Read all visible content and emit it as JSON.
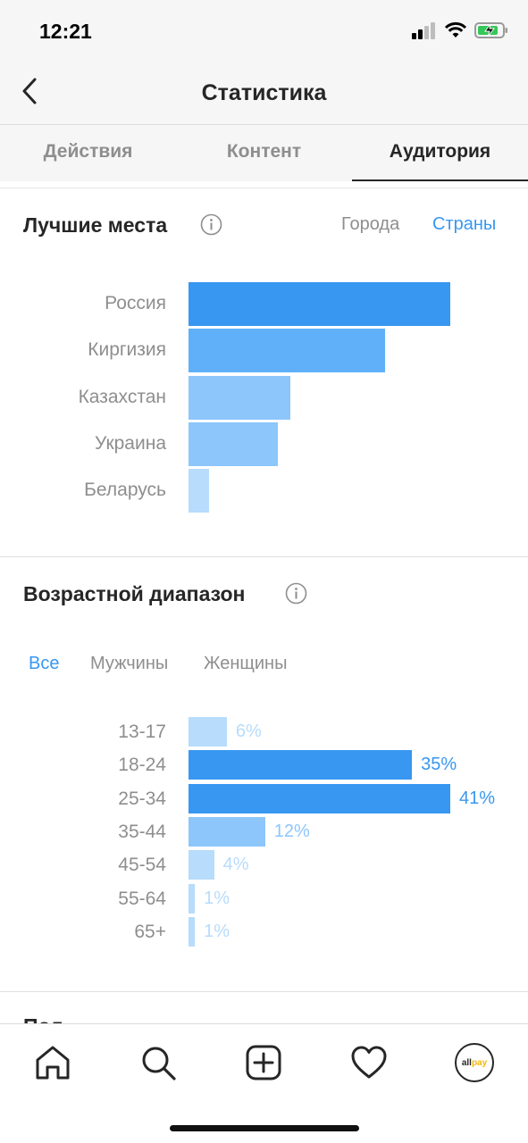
{
  "status": {
    "time": "12:21"
  },
  "header": {
    "title": "Статистика"
  },
  "tabs": [
    {
      "label": "Действия",
      "active": false
    },
    {
      "label": "Контент",
      "active": false
    },
    {
      "label": "Аудитория",
      "active": true
    }
  ],
  "top_places": {
    "title": "Лучшие места",
    "toggle": {
      "cities": "Города",
      "countries": "Страны",
      "selected": "countries"
    },
    "countries": [
      "Россия",
      "Киргизия",
      "Казахстан",
      "Украина",
      "Беларусь"
    ]
  },
  "age_range": {
    "title": "Возрастной диапазон",
    "filters": {
      "all": "Все",
      "men": "Мужчины",
      "women": "Женщины",
      "selected": "all"
    }
  },
  "gender": {
    "title": "Пол"
  },
  "bottom_nav": {
    "avatar_text_a": "all",
    "avatar_text_b": "pay"
  },
  "colors": {
    "accent": "#3897f0",
    "bar_dark": "#3897f0",
    "bar_mid": "#5fb0f8",
    "bar_light": "#8cc6fb",
    "bar_pale": "#b7dcfc"
  },
  "chart_data": [
    {
      "type": "bar",
      "orientation": "horizontal",
      "categories": [
        "Россия",
        "Киргизия",
        "Казахстан",
        "Украина",
        "Беларусь"
      ],
      "values": [
        100,
        75,
        39,
        34,
        8
      ],
      "xlabel": "",
      "ylabel": ""
    },
    {
      "type": "bar",
      "orientation": "horizontal",
      "categories": [
        "13-17",
        "18-24",
        "25-34",
        "35-44",
        "45-54",
        "55-64",
        "65+"
      ],
      "values": [
        6,
        35,
        41,
        12,
        4,
        1,
        1
      ],
      "value_labels": [
        "6%",
        "35%",
        "41%",
        "12%",
        "4%",
        "1%",
        "1%"
      ],
      "xlabel": "",
      "ylabel": ""
    }
  ]
}
